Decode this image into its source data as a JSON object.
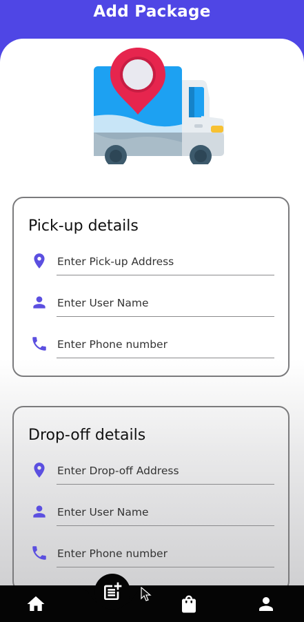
{
  "app_bar": {
    "title": "Add Package"
  },
  "colors": {
    "primary": "#4f46e5",
    "icon_purple": "#5b4fe0",
    "nav_bg": "#050505"
  },
  "hero": {
    "icon": "delivery-truck-with-location-pin"
  },
  "pickup": {
    "title": "Pick-up details",
    "address_placeholder": "Enter Pick-up Address",
    "name_placeholder": "Enter User Name",
    "phone_placeholder": "Enter Phone number"
  },
  "dropoff": {
    "title": "Drop-off details",
    "address_placeholder": "Enter Drop-off Address",
    "name_placeholder": "Enter User Name",
    "phone_placeholder": "Enter Phone number"
  },
  "bottom_nav": {
    "items": [
      {
        "icon": "home-icon"
      },
      {
        "icon": "add-post-icon"
      },
      {
        "icon": "shopping-bag-icon"
      },
      {
        "icon": "person-icon"
      }
    ]
  }
}
